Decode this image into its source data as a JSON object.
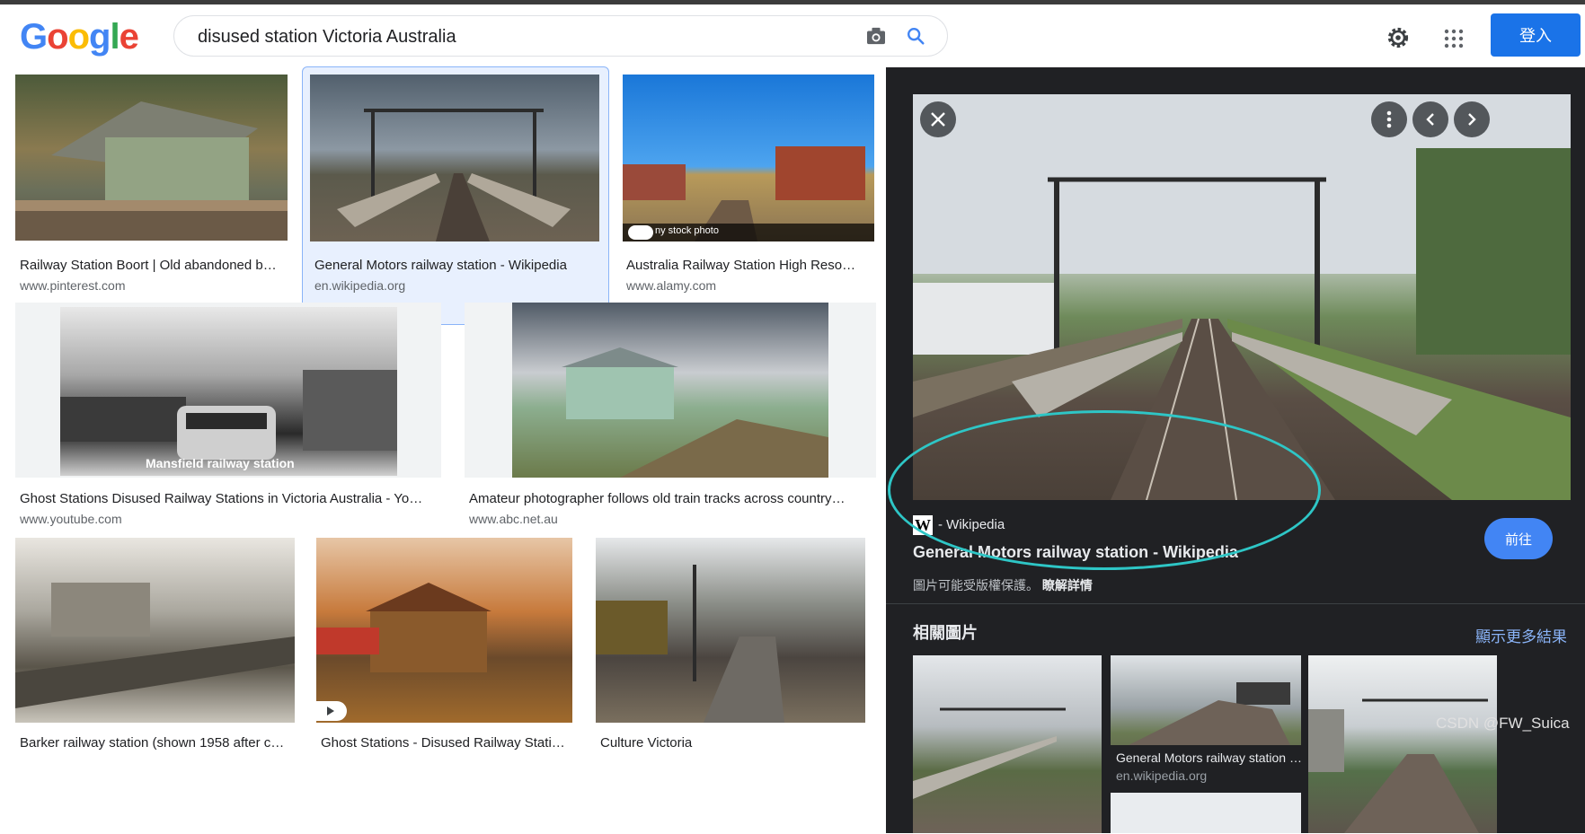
{
  "header": {
    "logo": {
      "letters": [
        "G",
        "o",
        "o",
        "g",
        "l",
        "e"
      ]
    },
    "search": {
      "value": "disused station Victoria Australia"
    },
    "signin_label": "登入"
  },
  "results": [
    {
      "caption": "Railway Station Boort | Old abandoned b…",
      "source": "www.pinterest.com"
    },
    {
      "caption": "General Motors railway station - Wikipedia",
      "source": "en.wikipedia.org"
    },
    {
      "caption": "Australia Railway Station High Reso…",
      "source": "www.alamy.com",
      "overlay": "ny stock photo"
    },
    {
      "caption": "Ghost Stations Disused Railway Stations in Victoria Australia - Yo…",
      "source": "www.youtube.com",
      "overlay": "Mansfield railway station"
    },
    {
      "caption": "Amateur photographer follows old train tracks across country…",
      "source": "www.abc.net.au"
    },
    {
      "caption": "Barker railway station (shown 1958 after c…",
      "source": ""
    },
    {
      "caption": "Ghost Stations - Disused Railway Stati…",
      "source": ""
    },
    {
      "caption": "Culture Victoria",
      "source": ""
    }
  ],
  "panel": {
    "site": "- Wikipedia",
    "title": "General Motors railway station - Wikipedia",
    "copyright": "圖片可能受版權保護。",
    "learn_more": "瞭解詳情",
    "visit_label": "前往",
    "related_label": "相關圖片",
    "more_label": "顯示更多結果",
    "related": [
      {
        "caption": "",
        "source": ""
      },
      {
        "caption": "General Motors railway station …",
        "source": "en.wikipedia.org"
      },
      {
        "caption": "",
        "source": ""
      }
    ]
  },
  "watermark": "CSDN @FW_Suica",
  "colors": {
    "accent": "#1a73e8",
    "panel_bg": "#202124",
    "annotation": "#2ec6c6"
  }
}
